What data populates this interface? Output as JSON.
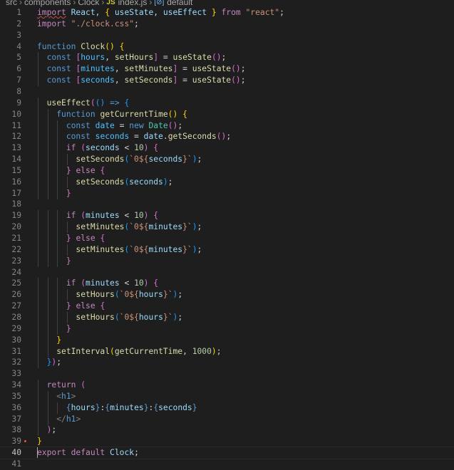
{
  "breadcrumb": {
    "items": [
      "src",
      "components",
      "Clock",
      "index.js",
      "default"
    ],
    "file_badge": "JS",
    "symbol_icon": "symbol-variable-icon"
  },
  "editor": {
    "active_line": 40,
    "language": "javascript",
    "lines": [
      [
        [
          "import",
          "k"
        ],
        [
          " React, ",
          "v0"
        ],
        [
          "{",
          "br1"
        ],
        [
          " useState, useEffect ",
          "v"
        ],
        [
          "}",
          "br1"
        ],
        [
          " from ",
          "k"
        ],
        [
          "\"react\"",
          "s"
        ],
        [
          ";",
          "p"
        ]
      ],
      [
        [
          "import",
          "k"
        ],
        [
          " ",
          "p"
        ],
        [
          "\"./clock.css\"",
          "s"
        ],
        [
          ";",
          "p"
        ]
      ],
      [],
      [
        [
          "function",
          "b"
        ],
        [
          " ",
          "p"
        ],
        [
          "Clock",
          "f"
        ],
        [
          "()",
          "br1"
        ],
        [
          " ",
          "p"
        ],
        [
          "{",
          "br1"
        ]
      ],
      [
        [
          "  ",
          "p"
        ],
        [
          "const",
          "b"
        ],
        [
          " ",
          "p"
        ],
        [
          "[",
          "br2"
        ],
        [
          "hours",
          "c"
        ],
        [
          ", ",
          "p"
        ],
        [
          "setHours",
          "f"
        ],
        [
          "]",
          "br2"
        ],
        [
          " = ",
          "p"
        ],
        [
          "useState",
          "f"
        ],
        [
          "()",
          "br2"
        ],
        [
          ";",
          "p"
        ]
      ],
      [
        [
          "  ",
          "p"
        ],
        [
          "const",
          "b"
        ],
        [
          " ",
          "p"
        ],
        [
          "[",
          "br2"
        ],
        [
          "minutes",
          "c"
        ],
        [
          ", ",
          "p"
        ],
        [
          "setMinutes",
          "f"
        ],
        [
          "]",
          "br2"
        ],
        [
          " = ",
          "p"
        ],
        [
          "useState",
          "f"
        ],
        [
          "()",
          "br2"
        ],
        [
          ";",
          "p"
        ]
      ],
      [
        [
          "  ",
          "p"
        ],
        [
          "const",
          "b"
        ],
        [
          " ",
          "p"
        ],
        [
          "[",
          "br2"
        ],
        [
          "seconds",
          "c"
        ],
        [
          ", ",
          "p"
        ],
        [
          "setSeconds",
          "f"
        ],
        [
          "]",
          "br2"
        ],
        [
          " = ",
          "p"
        ],
        [
          "useState",
          "f"
        ],
        [
          "()",
          "br2"
        ],
        [
          ";",
          "p"
        ]
      ],
      [],
      [
        [
          "  ",
          "p"
        ],
        [
          "useEffect",
          "f"
        ],
        [
          "(",
          "br2"
        ],
        [
          "()",
          "br3"
        ],
        [
          " => ",
          "b"
        ],
        [
          "{",
          "br3"
        ]
      ],
      [
        [
          "    ",
          "p"
        ],
        [
          "function",
          "b"
        ],
        [
          " ",
          "p"
        ],
        [
          "getCurrentTime",
          "f"
        ],
        [
          "()",
          "br1"
        ],
        [
          " ",
          "p"
        ],
        [
          "{",
          "br1"
        ]
      ],
      [
        [
          "      ",
          "p"
        ],
        [
          "const",
          "b"
        ],
        [
          " ",
          "p"
        ],
        [
          "date",
          "c"
        ],
        [
          " = ",
          "p"
        ],
        [
          "new",
          "b"
        ],
        [
          " ",
          "p"
        ],
        [
          "Date",
          "t"
        ],
        [
          "()",
          "br2"
        ],
        [
          ";",
          "p"
        ]
      ],
      [
        [
          "      ",
          "p"
        ],
        [
          "const",
          "b"
        ],
        [
          " ",
          "p"
        ],
        [
          "seconds",
          "c"
        ],
        [
          " = ",
          "p"
        ],
        [
          "date",
          "v"
        ],
        [
          ".",
          "p"
        ],
        [
          "getSeconds",
          "f"
        ],
        [
          "()",
          "br2"
        ],
        [
          ";",
          "p"
        ]
      ],
      [
        [
          "      ",
          "p"
        ],
        [
          "if",
          "k"
        ],
        [
          " ",
          "p"
        ],
        [
          "(",
          "br2"
        ],
        [
          "seconds",
          "v"
        ],
        [
          " < ",
          "p"
        ],
        [
          "10",
          "n"
        ],
        [
          ")",
          "br2"
        ],
        [
          " ",
          "p"
        ],
        [
          "{",
          "br2"
        ]
      ],
      [
        [
          "        ",
          "p"
        ],
        [
          "setSeconds",
          "f"
        ],
        [
          "(",
          "br3"
        ],
        [
          "`0${",
          "s"
        ],
        [
          "seconds",
          "v"
        ],
        [
          "}`",
          "s"
        ],
        [
          ")",
          "br3"
        ],
        [
          ";",
          "p"
        ]
      ],
      [
        [
          "      ",
          "p"
        ],
        [
          "}",
          "br2"
        ],
        [
          " ",
          "p"
        ],
        [
          "else",
          "k"
        ],
        [
          " ",
          "p"
        ],
        [
          "{",
          "br2"
        ]
      ],
      [
        [
          "        ",
          "p"
        ],
        [
          "setSeconds",
          "f"
        ],
        [
          "(",
          "br3"
        ],
        [
          "seconds",
          "v"
        ],
        [
          ")",
          "br3"
        ],
        [
          ";",
          "p"
        ]
      ],
      [
        [
          "      ",
          "p"
        ],
        [
          "}",
          "br2"
        ]
      ],
      [],
      [
        [
          "      ",
          "p"
        ],
        [
          "if",
          "k"
        ],
        [
          " ",
          "p"
        ],
        [
          "(",
          "br2"
        ],
        [
          "minutes",
          "v"
        ],
        [
          " < ",
          "p"
        ],
        [
          "10",
          "n"
        ],
        [
          ")",
          "br2"
        ],
        [
          " ",
          "p"
        ],
        [
          "{",
          "br2"
        ]
      ],
      [
        [
          "        ",
          "p"
        ],
        [
          "setMinutes",
          "f"
        ],
        [
          "(",
          "br3"
        ],
        [
          "`0${",
          "s"
        ],
        [
          "minutes",
          "v"
        ],
        [
          "}`",
          "s"
        ],
        [
          ")",
          "br3"
        ],
        [
          ";",
          "p"
        ]
      ],
      [
        [
          "      ",
          "p"
        ],
        [
          "}",
          "br2"
        ],
        [
          " ",
          "p"
        ],
        [
          "else",
          "k"
        ],
        [
          " ",
          "p"
        ],
        [
          "{",
          "br2"
        ]
      ],
      [
        [
          "        ",
          "p"
        ],
        [
          "setMinutes",
          "f"
        ],
        [
          "(",
          "br3"
        ],
        [
          "`0${",
          "s"
        ],
        [
          "minutes",
          "v"
        ],
        [
          "}`",
          "s"
        ],
        [
          ")",
          "br3"
        ],
        [
          ";",
          "p"
        ]
      ],
      [
        [
          "      ",
          "p"
        ],
        [
          "}",
          "br2"
        ]
      ],
      [],
      [
        [
          "      ",
          "p"
        ],
        [
          "if",
          "k"
        ],
        [
          " ",
          "p"
        ],
        [
          "(",
          "br2"
        ],
        [
          "minutes",
          "v"
        ],
        [
          " < ",
          "p"
        ],
        [
          "10",
          "n"
        ],
        [
          ")",
          "br2"
        ],
        [
          " ",
          "p"
        ],
        [
          "{",
          "br2"
        ]
      ],
      [
        [
          "        ",
          "p"
        ],
        [
          "setHours",
          "f"
        ],
        [
          "(",
          "br3"
        ],
        [
          "`0${",
          "s"
        ],
        [
          "hours",
          "v"
        ],
        [
          "}`",
          "s"
        ],
        [
          ")",
          "br3"
        ],
        [
          ";",
          "p"
        ]
      ],
      [
        [
          "      ",
          "p"
        ],
        [
          "}",
          "br2"
        ],
        [
          " ",
          "p"
        ],
        [
          "else",
          "k"
        ],
        [
          " ",
          "p"
        ],
        [
          "{",
          "br2"
        ]
      ],
      [
        [
          "        ",
          "p"
        ],
        [
          "setHours",
          "f"
        ],
        [
          "(",
          "br3"
        ],
        [
          "`0${",
          "s"
        ],
        [
          "hours",
          "v"
        ],
        [
          "}`",
          "s"
        ],
        [
          ")",
          "br3"
        ],
        [
          ";",
          "p"
        ]
      ],
      [
        [
          "      ",
          "p"
        ],
        [
          "}",
          "br2"
        ]
      ],
      [
        [
          "    ",
          "p"
        ],
        [
          "}",
          "br1"
        ]
      ],
      [
        [
          "    ",
          "p"
        ],
        [
          "setInterval",
          "f"
        ],
        [
          "(",
          "br1"
        ],
        [
          "getCurrentTime",
          "f"
        ],
        [
          ", ",
          "p"
        ],
        [
          "1000",
          "n"
        ],
        [
          ")",
          "br1"
        ],
        [
          ";",
          "p"
        ]
      ],
      [
        [
          "  ",
          "p"
        ],
        [
          "}",
          "br3"
        ],
        [
          ")",
          "br2"
        ],
        [
          ";",
          "p"
        ]
      ],
      [],
      [
        [
          "  ",
          "p"
        ],
        [
          "return",
          "k"
        ],
        [
          " ",
          "p"
        ],
        [
          "(",
          "br2"
        ]
      ],
      [
        [
          "    ",
          "p"
        ],
        [
          "<",
          "g"
        ],
        [
          "h1",
          "tg"
        ],
        [
          ">",
          "g"
        ]
      ],
      [
        [
          "      ",
          "p"
        ],
        [
          "{",
          "b"
        ],
        [
          "hours",
          "v"
        ],
        [
          "}",
          "b"
        ],
        [
          ":",
          "p"
        ],
        [
          "{",
          "b"
        ],
        [
          "minutes",
          "v"
        ],
        [
          "}",
          "b"
        ],
        [
          ":",
          "p"
        ],
        [
          "{",
          "b"
        ],
        [
          "seconds",
          "v"
        ],
        [
          "}",
          "b"
        ]
      ],
      [
        [
          "    ",
          "p"
        ],
        [
          "</",
          "g"
        ],
        [
          "h1",
          "tg"
        ],
        [
          ">",
          "g"
        ]
      ],
      [
        [
          "  ",
          "p"
        ],
        [
          ")",
          "br2"
        ],
        [
          ";",
          "p"
        ]
      ],
      [
        [
          "}",
          "br1"
        ]
      ],
      [
        [
          "export",
          "k"
        ],
        [
          " ",
          "p"
        ],
        [
          "default",
          "k"
        ],
        [
          " ",
          "p"
        ],
        [
          "Clock",
          "v"
        ],
        [
          ";",
          "p"
        ]
      ],
      []
    ]
  }
}
